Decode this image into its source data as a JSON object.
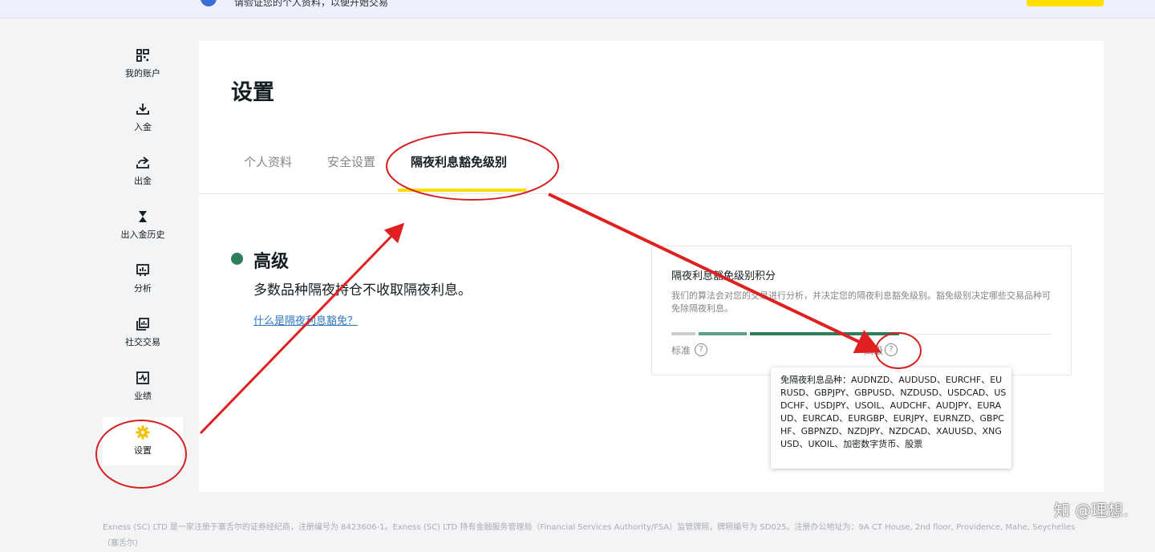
{
  "banner": {
    "text": "请验证您的个人资料，以便开始交易",
    "button_label": ""
  },
  "sidebar": {
    "items": [
      {
        "label": "我的账户",
        "icon": "grid-icon"
      },
      {
        "label": "入金",
        "icon": "download-icon"
      },
      {
        "label": "出金",
        "icon": "upload-icon"
      },
      {
        "label": "出入金历史",
        "icon": "hourglass-icon"
      },
      {
        "label": "分析",
        "icon": "analytics-icon"
      },
      {
        "label": "社交交易",
        "icon": "social-trading-icon"
      },
      {
        "label": "业绩",
        "icon": "performance-icon"
      },
      {
        "label": "设置",
        "icon": "gear-icon",
        "active": true
      }
    ]
  },
  "page": {
    "title": "设置",
    "tabs": [
      {
        "label": "个人资料"
      },
      {
        "label": "安全设置"
      },
      {
        "label": "隔夜利息豁免级别",
        "active": true
      }
    ]
  },
  "swap_level": {
    "name": "高级",
    "description": "多数品种隔夜持仓不收取隔夜利息。",
    "link": "什么是隔夜利息豁免？",
    "accent_color": "#2f7d5a"
  },
  "score_panel": {
    "title": "隔夜利息豁免级别积分",
    "description": "我们的算法会对您的交易进行分析，并决定您的隔夜利息豁免级别。豁免级别决定哪些交易品种可免除隔夜利息。",
    "label_start": "标准",
    "label_end": "高级",
    "help_glyph": "?"
  },
  "tooltip": {
    "text": "免隔夜利息品种：AUDNZD、AUDUSD、EURCHF、EURUSD、GBPJPY、GBPUSD、NZDUSD、USDCAD、USDCHF、USDJPY、USOIL、AUDCHF、AUDJPY、EURAUD、EURCAD、EURGBP、EURJPY、EURNZD、GBPCHF、GBPNZD、NZDJPY、NZDCAD、XAUUSD、XNGUSD、UKOIL、加密数字货币、股票"
  },
  "footer": {
    "text": "Exness (SC) LTD 是一家注册于塞舌尔的证券经纪商，注册编号为 8423606-1。Exness (SC) LTD 持有金融服务管理局（Financial Services Authority/FSA）监管牌照，牌照编号为 SD025。注册办公地址为：9A CT House, 2nd floor, Providence, Mahe, Seychelles（塞舌尔）"
  },
  "watermark": {
    "text": "知 @理想."
  },
  "colors": {
    "brand_yellow": "#ffde02",
    "annotation_red": "#e02020"
  }
}
